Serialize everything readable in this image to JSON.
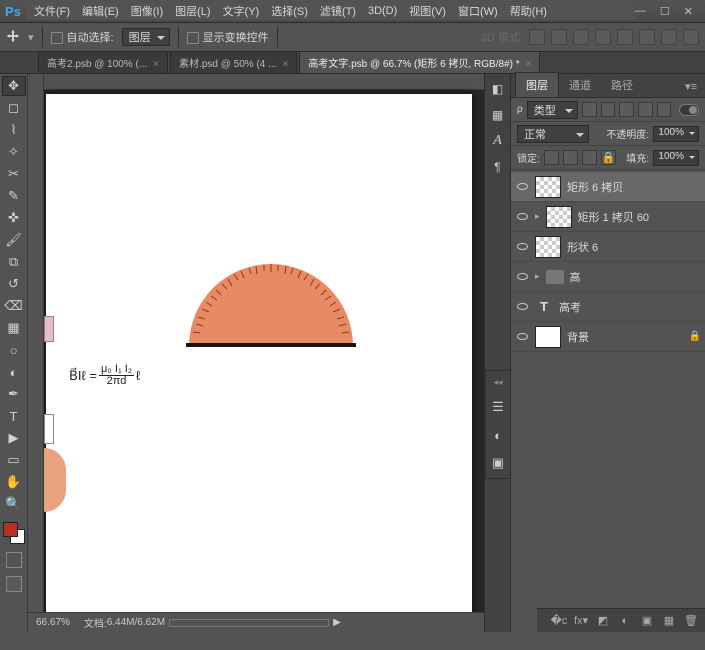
{
  "menu": {
    "file": "文件(F)",
    "edit": "编辑(E)",
    "image": "图像(I)",
    "layer": "图层(L)",
    "type": "文字(Y)",
    "select": "选择(S)",
    "filter": "滤镜(T)",
    "threeD": "3D(D)",
    "view": "视图(V)",
    "window": "窗口(W)",
    "help": "帮助(H)"
  },
  "options": {
    "autoSelect": "自动选择:",
    "autoSelectMode": "图层",
    "showTransform": "显示变换控件",
    "threeDMode": "3D 模式:"
  },
  "tabs": [
    {
      "label": "高考2.psb @ 100% (..."
    },
    {
      "label": "素材.psd @ 50% (4 ..."
    },
    {
      "label": "高考文字.psb @ 66.7% (矩形 6 拷贝, RGB/8#) *",
      "active": true
    }
  ],
  "status": {
    "zoom": "66.67%",
    "docLabel": "文档:",
    "docSize": "6.44M/6.62M"
  },
  "panel": {
    "tabs": {
      "layers": "图层",
      "channels": "通道",
      "paths": "路径"
    },
    "filterLabel": "类型",
    "blend": {
      "mode": "正常",
      "opacityLabel": "不透明度:",
      "opacity": "100%"
    },
    "lock": {
      "label": "锁定:",
      "fillLabel": "填充:",
      "fill": "100%"
    },
    "layers": [
      {
        "name": "矩形 6 拷贝",
        "kind": "shape",
        "selected": true
      },
      {
        "name": "矩形 1 拷贝 60",
        "kind": "shape"
      },
      {
        "name": "形状 6",
        "kind": "shape"
      },
      {
        "name": "高",
        "kind": "group"
      },
      {
        "name": "高考",
        "kind": "text"
      },
      {
        "name": "背景",
        "kind": "solid",
        "locked": true
      }
    ]
  },
  "swatch": {
    "fg": "#b82f24",
    "bg": "#ffffff"
  },
  "equation": {
    "lhs": "B⃗Iℓ =",
    "num": "μ₀ I₁ I₂",
    "den": "2πd",
    "tail": "ℓ"
  }
}
